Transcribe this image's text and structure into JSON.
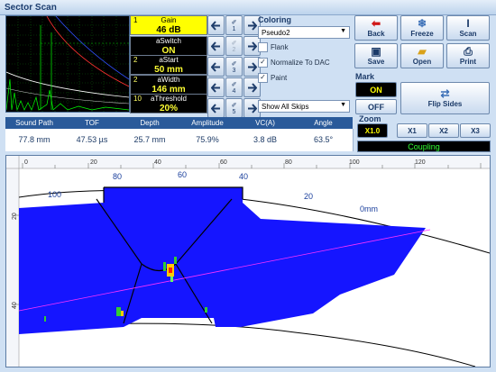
{
  "window": {
    "title": "Sector Scan"
  },
  "params": [
    {
      "num": "1",
      "label": "Gain",
      "value": "46 dB",
      "selected": true
    },
    {
      "num": "",
      "label": "aSwitch",
      "value": "ON"
    },
    {
      "num": "2",
      "label": "aStart",
      "value": "50 mm"
    },
    {
      "num": "2",
      "label": "aWidth",
      "value": "146 mm"
    },
    {
      "num": "10",
      "label": "aThreshold",
      "value": "20%"
    }
  ],
  "steps": [
    "1",
    "2",
    "3",
    "4",
    "5"
  ],
  "coloring": {
    "title": "Coloring",
    "palette": "Pseudo2",
    "flank": "Flank",
    "normalize": "Normalize To DAC",
    "paint": "Paint",
    "skips": "Show All Skips"
  },
  "buttons": {
    "back": "Back",
    "freeze": "Freeze",
    "scan": "Scan",
    "save": "Save",
    "open": "Open",
    "print": "Print",
    "flip": "Flip Sides"
  },
  "mark": {
    "title": "Mark",
    "on": "ON",
    "off": "OFF"
  },
  "zoom": {
    "title": "Zoom",
    "options": [
      "X1.0",
      "X1",
      "X2",
      "X3"
    ]
  },
  "coupling": "Coupling",
  "measurements": {
    "headers": [
      "Sound Path",
      "TOF",
      "Depth",
      "Amplitude",
      "VC(A)",
      "Angle"
    ],
    "values": [
      "77.8 mm",
      "47.53 µs",
      "25.7 mm",
      "75.9%",
      "3.8 dB",
      "63.5°"
    ]
  },
  "scan": {
    "top_ticks": [
      "0",
      "20",
      "40",
      "60",
      "80",
      "100",
      "120"
    ],
    "left_ticks": [
      "20",
      "40"
    ],
    "arc_labels": [
      "100",
      "80",
      "60",
      "40",
      "20",
      "0mm"
    ]
  },
  "colors": {
    "accent": "#ffff00",
    "fill": "#1515ff",
    "panel": "#cfe0f3"
  }
}
